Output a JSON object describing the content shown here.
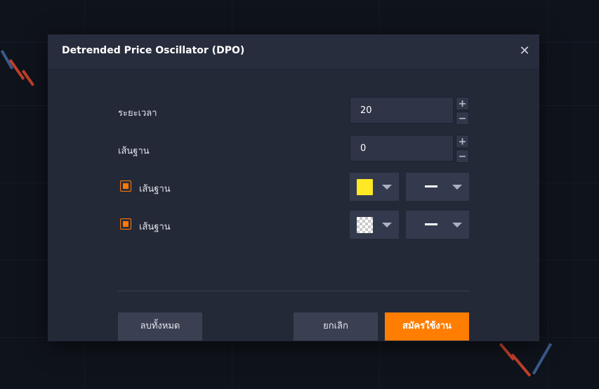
{
  "dialog": {
    "title": "Detrended Price Oscillator (DPO)",
    "close_icon": "close-icon"
  },
  "fields": {
    "period": {
      "label": "ระยะเวลา",
      "value": "20"
    },
    "baseline": {
      "label": "เส้นฐาน",
      "value": "0"
    },
    "stepper_plus": "+",
    "stepper_minus": "−"
  },
  "style_rows": [
    {
      "label": "เส้นฐาน",
      "checked": true,
      "color": "#ffe824",
      "line_style": "solid"
    },
    {
      "label": "เส้นฐาน",
      "checked": true,
      "color": "transparent",
      "line_style": "solid"
    }
  ],
  "buttons": {
    "reset": "ลบทั้งหมด",
    "cancel": "ยกเลิก",
    "apply": "สมัครใช้งาน"
  },
  "colors": {
    "accent": "#ff7d00",
    "dialog_bg": "#242938",
    "header_bg": "#282d3d"
  }
}
